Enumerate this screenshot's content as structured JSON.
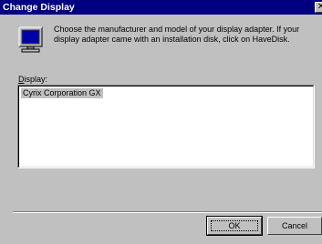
{
  "window": {
    "title": "Change Display",
    "close_glyph": "✕"
  },
  "instructions": "Choose the manufacturer and model of your display adapter.  If your display adapter came with an installation disk, click on HaveDisk.",
  "display": {
    "label_mnemonic": "D",
    "label_rest": "isplay:",
    "items": [
      "Cyrix Corporation GX"
    ],
    "selected_index": 0
  },
  "buttons": {
    "ok": "OK",
    "cancel": "Cancel"
  },
  "icons": {
    "monitor": "monitor-icon"
  },
  "colors": {
    "titlebar": "#000080",
    "face": "#c0c0c0",
    "monitor_screen": "#0000a8"
  }
}
